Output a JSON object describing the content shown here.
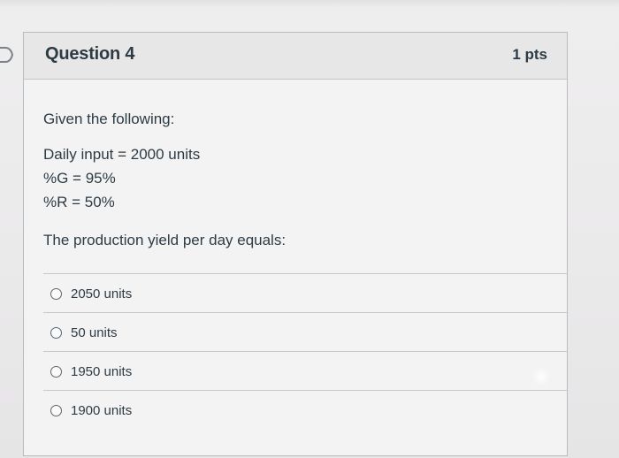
{
  "question": {
    "title": "Question 4",
    "points": "1 pts",
    "prompt_intro": "Given the following:",
    "givens": [
      "Daily input = 2000 units",
      "%G = 95%",
      "%R = 50%"
    ],
    "prompt_question": "The production yield per day equals:",
    "answers": [
      {
        "label": "2050 units",
        "selected": false
      },
      {
        "label": "50 units",
        "selected": false
      },
      {
        "label": "1950 units",
        "selected": false
      },
      {
        "label": "1900 units",
        "selected": false
      }
    ]
  },
  "colors": {
    "text": "#2d3b45",
    "header_bg": "#e7e7e8",
    "card_bg": "#f3f3f3",
    "border": "#b9bcbf"
  },
  "icons": {
    "flag": "flag-marker-icon",
    "radio": "radio-unselected-icon"
  }
}
